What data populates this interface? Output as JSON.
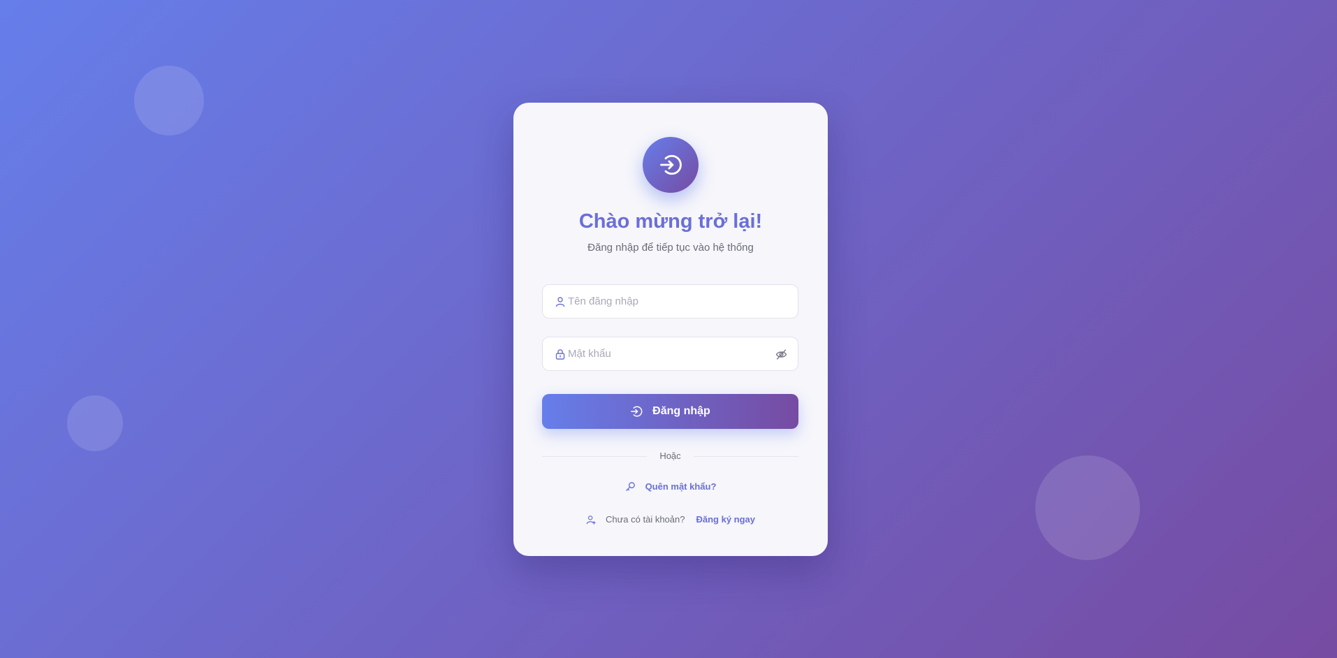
{
  "login": {
    "title": "Chào mừng trở lại!",
    "subtitle": "Đăng nhập để tiếp tục vào hệ thống",
    "username_placeholder": "Tên đăng nhập",
    "password_placeholder": "Mật khẩu",
    "submit_label": "Đăng nhập",
    "divider_text": "Hoặc",
    "forgot_label": "Quên mật khẩu?",
    "signup_prompt": "Chưa có tài khoản?",
    "signup_label": "Đăng ký ngay"
  },
  "icons": {
    "logo": "sign-in-icon",
    "username": "user-icon",
    "password": "lock-icon",
    "toggle_password": "eye-slash-icon",
    "submit": "sign-in-icon",
    "forgot": "key-icon",
    "signup": "user-plus-icon"
  },
  "colors": {
    "gradient_start": "#667eea",
    "gradient_end": "#764ba2",
    "accent_text": "#6a6fd6"
  }
}
